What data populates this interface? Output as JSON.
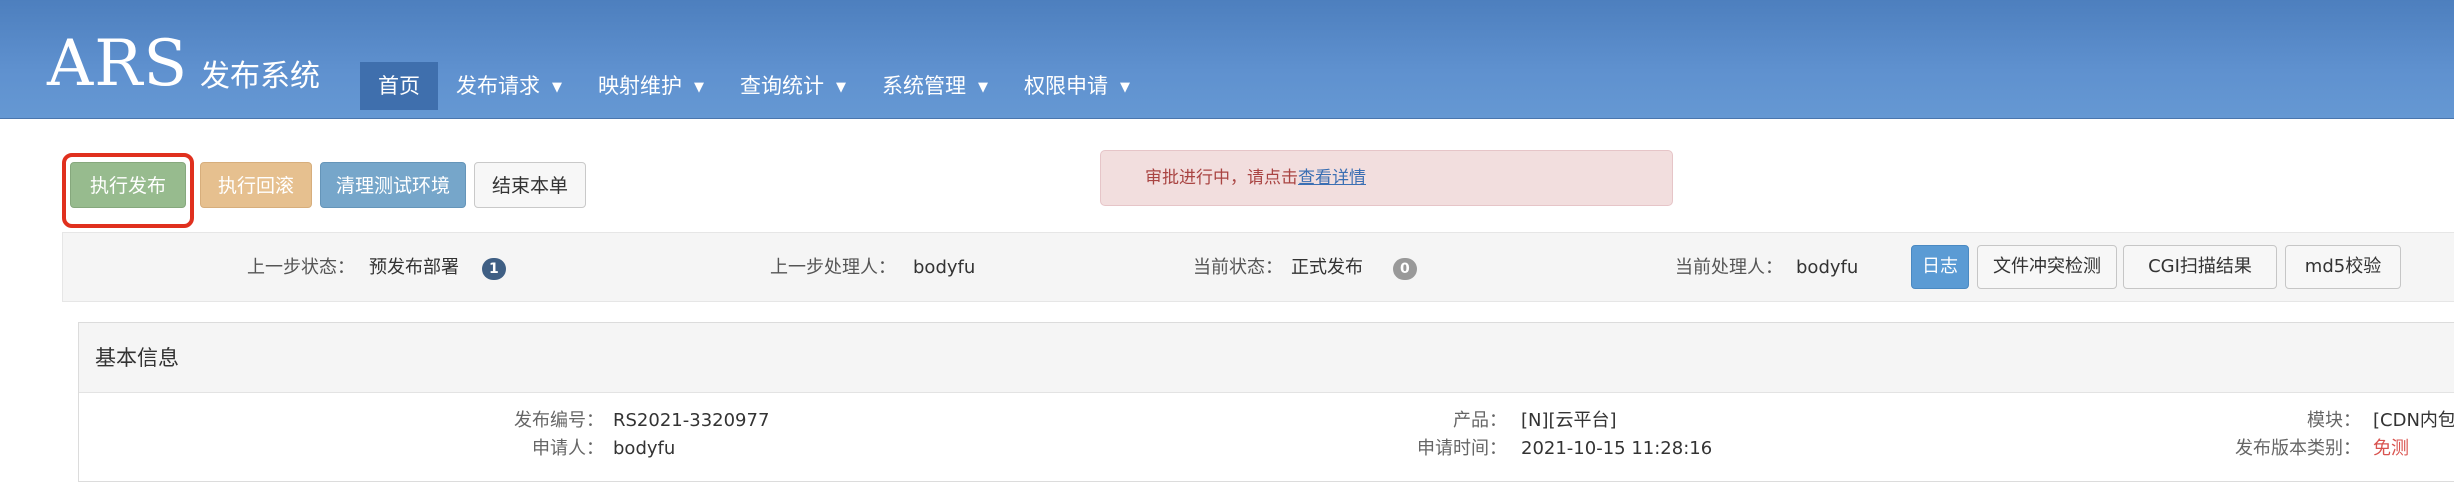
{
  "header": {
    "logo_main": "ARS",
    "logo_sub": "发布系统",
    "nav": [
      {
        "label": "首页",
        "active": true
      },
      {
        "label": "发布请求",
        "dropdown": true
      },
      {
        "label": "映射维护",
        "dropdown": true
      },
      {
        "label": "查询统计",
        "dropdown": true
      },
      {
        "label": "系统管理",
        "dropdown": true
      },
      {
        "label": "权限申请",
        "dropdown": true
      }
    ]
  },
  "actions": {
    "execute_release": "执行发布",
    "execute_rollback": "执行回滚",
    "clean_test_env": "清理测试环境",
    "close_ticket": "结束本单"
  },
  "alert": {
    "text": "审批进行中，请点击",
    "link": "查看详情"
  },
  "status": {
    "prev_state_label": "上一步状态：",
    "prev_state_value": "预发布部署",
    "prev_state_badge": "1",
    "prev_handler_label": "上一步处理人：",
    "prev_handler_value": "bodyfu",
    "current_state_label": "当前状态：",
    "current_state_value": "正式发布",
    "current_state_badge": "0",
    "current_handler_label": "当前处理人：",
    "current_handler_value": "bodyfu",
    "tools": {
      "log": "日志",
      "file_conflict": "文件冲突检测",
      "cgi_scan": "CGI扫描结果",
      "md5_check": "md5校验"
    }
  },
  "info": {
    "title": "基本信息",
    "release_no_label": "发布编号：",
    "release_no_value": "RS2021-3320977",
    "applicant_label": "申请人：",
    "applicant_value": "bodyfu",
    "product_label": "产品：",
    "product_value": "[N][云平台]",
    "apply_time_label": "申请时间：",
    "apply_time_value": "2021-10-15 11:28:16",
    "module_label": "模块：",
    "module_value": "[CDN内包][",
    "version_type_label": "发布版本类别：",
    "version_type_value": "免测"
  },
  "colors": {
    "header_bg": "#5f91cf",
    "execute_green": "#97bb8e",
    "rollback_orange": "#e6c08f",
    "clean_blue": "#76a6ca",
    "highlight_red": "#e0301e",
    "alert_bg": "#f2dede",
    "badge_dark": "#3f5f84",
    "badge_grey": "#999999",
    "version_type_red": "#d9534f"
  }
}
